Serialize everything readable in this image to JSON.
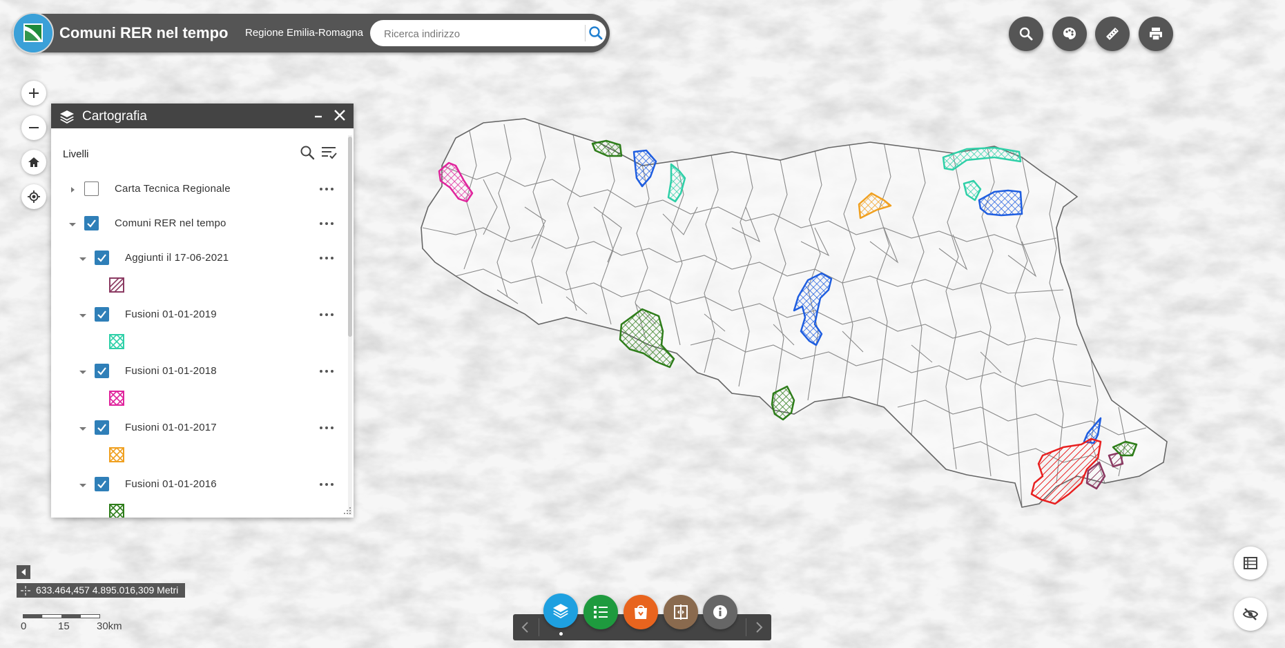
{
  "header": {
    "title": "Comuni RER nel tempo",
    "subtitle": "Regione Emilia-Romagna",
    "search_placeholder": "Ricerca indirizzo"
  },
  "toolbar": {
    "icons": [
      "search-icon",
      "palette-icon",
      "ruler-icon",
      "print-icon"
    ]
  },
  "map_controls": {
    "zoom_in_icon": "plus-icon",
    "zoom_out_icon": "minus-icon",
    "home_icon": "home-icon",
    "locate_icon": "locate-icon"
  },
  "panel": {
    "title": "Cartografia",
    "section_label": "Livelli",
    "layers": [
      {
        "label": "Carta Tecnica Regionale",
        "checked": false,
        "expanded": false
      },
      {
        "label": "Comuni RER nel tempo",
        "checked": true,
        "expanded": true
      },
      {
        "label": "Aggiunti il 17-06-2021",
        "checked": true,
        "expanded": true,
        "swatch_color": "#8b3a62"
      },
      {
        "label": "Fusioni 01-01-2019",
        "checked": true,
        "expanded": true,
        "swatch_color": "#2fd0a8"
      },
      {
        "label": "Fusioni 01-01-2018",
        "checked": true,
        "expanded": true,
        "swatch_color": "#e0249c"
      },
      {
        "label": "Fusioni 01-01-2017",
        "checked": true,
        "expanded": true,
        "swatch_color": "#f0a020"
      },
      {
        "label": "Fusioni 01-01-2016",
        "checked": true,
        "expanded": true,
        "swatch_color": "#2e7d1a"
      }
    ]
  },
  "coordinates": {
    "text": "633.464,457 4.895.016,309 Metri"
  },
  "scale": {
    "labels": [
      "0",
      "15",
      "30km"
    ]
  },
  "dock": {
    "buttons": [
      {
        "icon": "layers-icon",
        "color": "#1ea0e0"
      },
      {
        "icon": "legend-icon",
        "color": "#1e9a3e"
      },
      {
        "icon": "basemap-icon",
        "color": "#e8641e"
      },
      {
        "icon": "swipe-icon",
        "color": "#8a6a4e"
      },
      {
        "icon": "info-icon",
        "color": "#666666"
      }
    ]
  },
  "colors": {
    "accent": "#2f7fb8",
    "header_bg": "#555555",
    "panel_header_bg": "#444444",
    "boundary": "#6a6a6a"
  }
}
